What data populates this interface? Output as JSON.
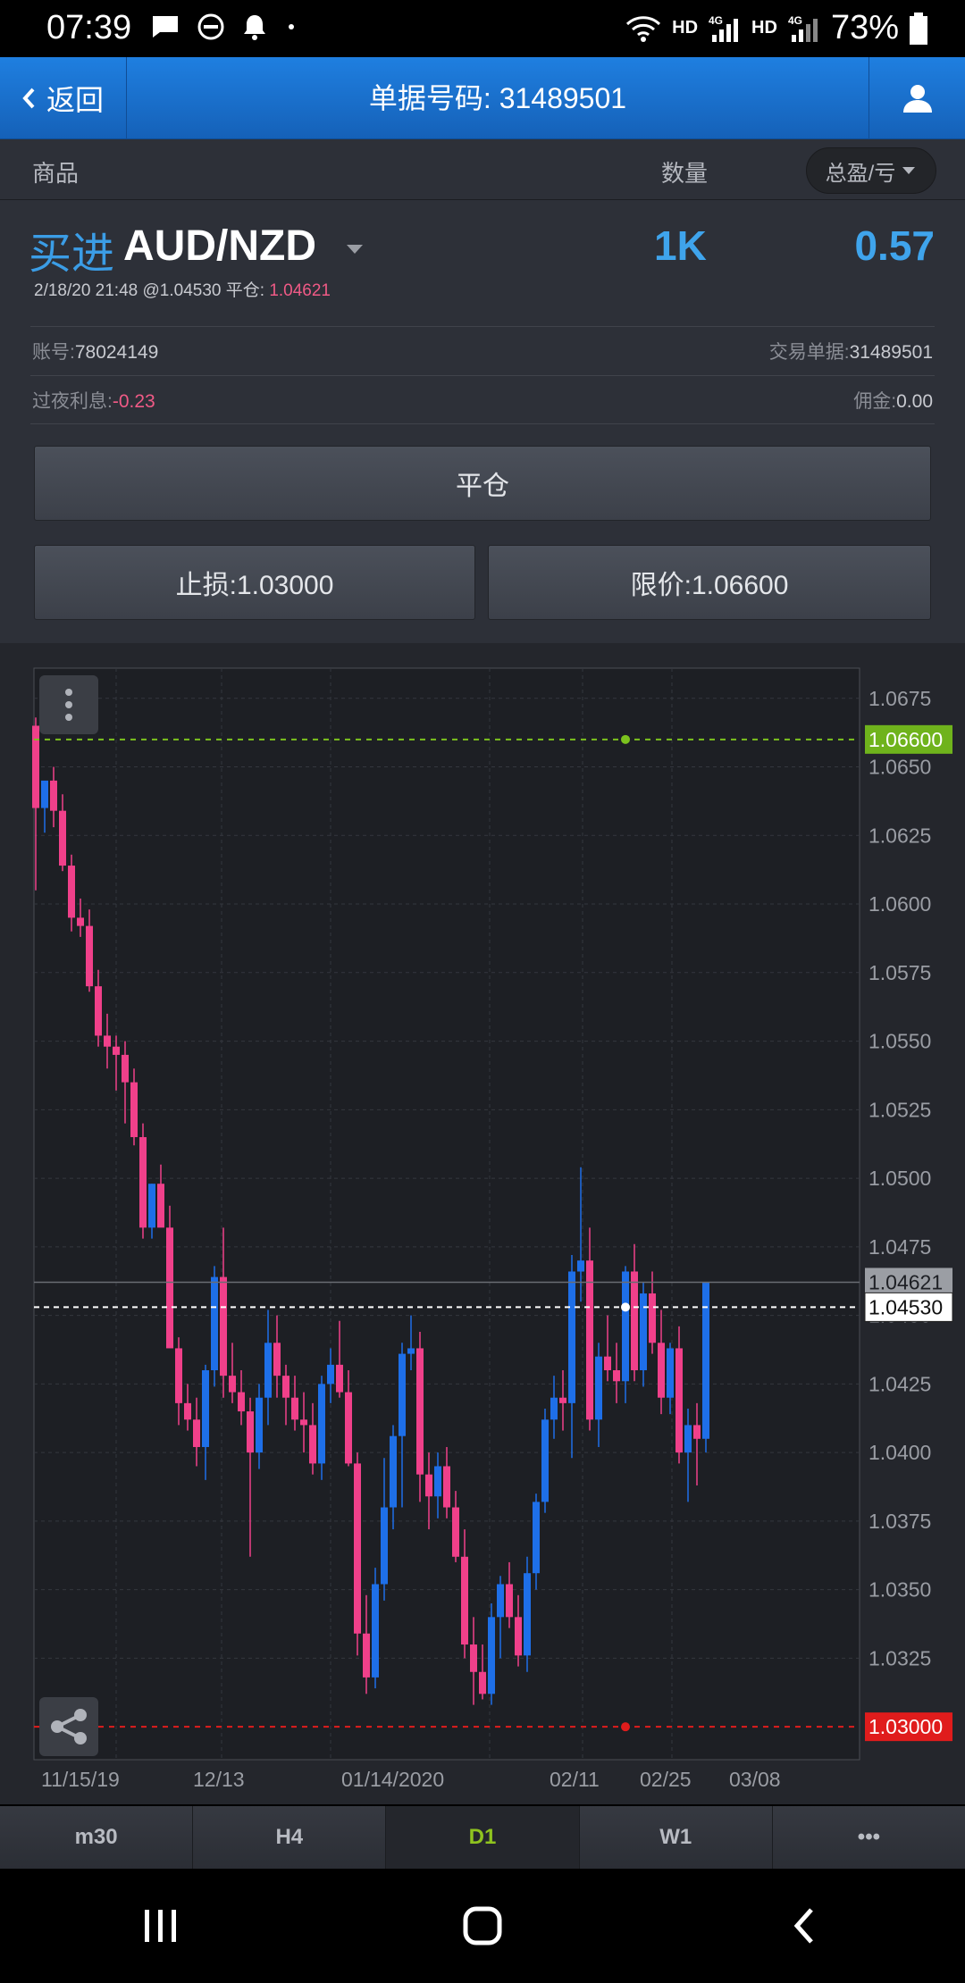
{
  "status_bar": {
    "time": "07:39",
    "network_1": "HD",
    "network_2": "HD",
    "net_type_1": "4G",
    "net_type_2": "4G",
    "battery": "73%",
    "icons": [
      "message-icon",
      "do-not-disturb-icon",
      "notification-bell-icon",
      "dot-icon",
      "wifi-icon",
      "signal-icon",
      "battery-icon"
    ]
  },
  "header": {
    "back_label": "返回",
    "title": "单据号码: 31489501",
    "user_icon": "user-icon"
  },
  "columns": {
    "product": "商品",
    "quantity": "数量",
    "pl_selector": "总盈/亏"
  },
  "trade": {
    "side": "买进",
    "symbol": "AUD/NZD",
    "quantity": "1K",
    "pl": "0.57",
    "open_info": "2/18/20 21:48 @1.04530 平仓:",
    "close_price": "1.04621",
    "account_label": "账号:",
    "account": "78024149",
    "ticket_label": "交易单据:",
    "ticket": "31489501",
    "swap_label": "过夜利息:",
    "swap": "-0.23",
    "commission_label": "佣金:",
    "commission": "0.00"
  },
  "buttons": {
    "close_position": "平仓",
    "stop_loss": "止损:1.03000",
    "limit": "限价:1.06600"
  },
  "chart_data": {
    "type": "candlestick",
    "y_ticks": [
      "1.0675",
      "1.0650",
      "1.0625",
      "1.0600",
      "1.0575",
      "1.0550",
      "1.0525",
      "1.0500",
      "1.0475",
      "1.0450",
      "1.0425",
      "1.0400",
      "1.0375",
      "1.0350",
      "1.0325"
    ],
    "x_ticks": [
      "11/15/19",
      "12/13",
      "01/14/2020",
      "02/11",
      "02/25",
      "03/08"
    ],
    "ylim": [
      1.0288,
      1.0686
    ],
    "limit_line": {
      "value": 1.066,
      "label": "1.06600",
      "color": "#7cc21e"
    },
    "stop_line": {
      "value": 1.03,
      "label": "1.03000",
      "color": "#e01c1c"
    },
    "entry_line": {
      "value": 1.0453,
      "label": "1.04530"
    },
    "current_line": {
      "value": 1.04621,
      "label": "1.04621"
    },
    "candles": [
      [
        1.0665,
        1.0668,
        1.0605,
        1.0635
      ],
      [
        1.0635,
        1.0642,
        1.0626,
        1.0645
      ],
      [
        1.0645,
        1.065,
        1.0628,
        1.0634
      ],
      [
        1.0634,
        1.064,
        1.0612,
        1.0614
      ],
      [
        1.0614,
        1.0618,
        1.059,
        1.0595
      ],
      [
        1.0595,
        1.0602,
        1.0588,
        1.0592
      ],
      [
        1.0592,
        1.0598,
        1.0568,
        1.057
      ],
      [
        1.057,
        1.0576,
        1.0548,
        1.0552
      ],
      [
        1.0552,
        1.056,
        1.054,
        1.0548
      ],
      [
        1.0548,
        1.0552,
        1.0532,
        1.0545
      ],
      [
        1.0545,
        1.055,
        1.052,
        1.0535
      ],
      [
        1.0535,
        1.054,
        1.0512,
        1.0515
      ],
      [
        1.0515,
        1.052,
        1.0478,
        1.0482
      ],
      [
        1.0482,
        1.0498,
        1.0478,
        1.0498
      ],
      [
        1.0498,
        1.0505,
        1.0485,
        1.0482
      ],
      [
        1.0482,
        1.049,
        1.047,
        1.0438
      ],
      [
        1.0438,
        1.0442,
        1.041,
        1.0418
      ],
      [
        1.0418,
        1.0425,
        1.0408,
        1.0412
      ],
      [
        1.0412,
        1.042,
        1.0395,
        1.0402
      ],
      [
        1.0402,
        1.0432,
        1.039,
        1.043
      ],
      [
        1.043,
        1.0468,
        1.0424,
        1.0464
      ],
      [
        1.0464,
        1.0482,
        1.042,
        1.0428
      ],
      [
        1.0428,
        1.044,
        1.0418,
        1.0422
      ],
      [
        1.0422,
        1.043,
        1.041,
        1.0415
      ],
      [
        1.0415,
        1.042,
        1.0362,
        1.04
      ],
      [
        1.04,
        1.0425,
        1.0394,
        1.042
      ],
      [
        1.042,
        1.0452,
        1.041,
        1.044
      ],
      [
        1.044,
        1.045,
        1.042,
        1.0428
      ],
      [
        1.0428,
        1.0432,
        1.041,
        1.042
      ],
      [
        1.042,
        1.0428,
        1.0408,
        1.0412
      ],
      [
        1.0412,
        1.0422,
        1.04,
        1.041
      ],
      [
        1.041,
        1.0418,
        1.0392,
        1.0396
      ],
      [
        1.0396,
        1.0428,
        1.039,
        1.0425
      ],
      [
        1.0425,
        1.0438,
        1.0418,
        1.0432
      ],
      [
        1.0432,
        1.0448,
        1.042,
        1.0422
      ],
      [
        1.0422,
        1.043,
        1.0395,
        1.0396
      ],
      [
        1.0396,
        1.04,
        1.0326,
        1.0334
      ],
      [
        1.0334,
        1.0348,
        1.0312,
        1.0318
      ],
      [
        1.0318,
        1.0358,
        1.0314,
        1.0352
      ],
      [
        1.0352,
        1.0398,
        1.0346,
        1.038
      ],
      [
        1.038,
        1.041,
        1.0372,
        1.0406
      ],
      [
        1.0406,
        1.044,
        1.038,
        1.0436
      ],
      [
        1.0436,
        1.045,
        1.043,
        1.0438
      ],
      [
        1.0438,
        1.0444,
        1.0382,
        1.0392
      ],
      [
        1.0392,
        1.04,
        1.0372,
        1.0384
      ],
      [
        1.0384,
        1.04,
        1.0376,
        1.0395
      ],
      [
        1.0395,
        1.0402,
        1.0376,
        1.038
      ],
      [
        1.038,
        1.0386,
        1.036,
        1.0362
      ],
      [
        1.0362,
        1.0372,
        1.0325,
        1.033
      ],
      [
        1.033,
        1.034,
        1.0308,
        1.032
      ],
      [
        1.032,
        1.033,
        1.031,
        1.0312
      ],
      [
        1.0312,
        1.0345,
        1.0308,
        1.034
      ],
      [
        1.034,
        1.0355,
        1.0325,
        1.0352
      ],
      [
        1.0352,
        1.036,
        1.0336,
        1.034
      ],
      [
        1.034,
        1.0348,
        1.0322,
        1.0326
      ],
      [
        1.0326,
        1.0362,
        1.032,
        1.0356
      ],
      [
        1.0356,
        1.0385,
        1.035,
        1.0382
      ],
      [
        1.0382,
        1.0416,
        1.0378,
        1.0412
      ],
      [
        1.0412,
        1.0428,
        1.0405,
        1.042
      ],
      [
        1.042,
        1.043,
        1.0408,
        1.0418
      ],
      [
        1.0418,
        1.0472,
        1.0398,
        1.0466
      ],
      [
        1.0466,
        1.0504,
        1.0455,
        1.047
      ],
      [
        1.047,
        1.0482,
        1.0408,
        1.0412
      ],
      [
        1.0412,
        1.044,
        1.0402,
        1.0435
      ],
      [
        1.0435,
        1.045,
        1.0426,
        1.043
      ],
      [
        1.043,
        1.044,
        1.0418,
        1.0426
      ],
      [
        1.0426,
        1.0468,
        1.0418,
        1.0466
      ],
      [
        1.0466,
        1.0476,
        1.0426,
        1.043
      ],
      [
        1.043,
        1.0462,
        1.0424,
        1.0458
      ],
      [
        1.0458,
        1.0466,
        1.0436,
        1.044
      ],
      [
        1.044,
        1.0452,
        1.0414,
        1.042
      ],
      [
        1.042,
        1.044,
        1.0414,
        1.0438
      ],
      [
        1.0438,
        1.0446,
        1.0396,
        1.04
      ],
      [
        1.04,
        1.0416,
        1.0382,
        1.041
      ],
      [
        1.041,
        1.0418,
        1.0388,
        1.0405
      ],
      [
        1.0405,
        1.0462,
        1.04,
        1.0462
      ]
    ],
    "up_color": "#1e6fe8",
    "down_color": "#f0408a"
  },
  "timeframes": {
    "tabs": [
      {
        "label": "m30",
        "active": false
      },
      {
        "label": "H4",
        "active": false
      },
      {
        "label": "D1",
        "active": true
      },
      {
        "label": "W1",
        "active": false
      },
      {
        "label": "•••",
        "active": false
      }
    ]
  },
  "nav": {
    "icons": [
      "recent-apps-icon",
      "home-icon",
      "back-icon"
    ]
  }
}
